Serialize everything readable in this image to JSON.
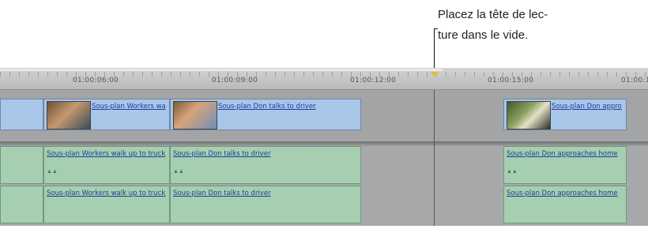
{
  "callout": {
    "line1": "Placez la tête de lec-",
    "line2": "ture dans le vide."
  },
  "ruler": {
    "timecodes": [
      "01:00:06:00",
      "01:00:09:00",
      "01:00:12:00",
      "01:00:15:00",
      "01:00:1"
    ]
  },
  "video_clips": [
    {
      "label": "Sous-plan Workers wa"
    },
    {
      "label": "Sous-plan Don talks to driver"
    },
    {
      "label": "Sous-plan Don appro"
    }
  ],
  "audio_track_1": [
    {
      "label": "Sous-plan Workers walk up to truck"
    },
    {
      "label": "Sous-plan Don talks to driver"
    },
    {
      "label": "Sous-plan Don approaches home"
    }
  ],
  "audio_track_2": [
    {
      "label": "Sous-plan Workers walk up to truck"
    },
    {
      "label": "Sous-plan Don talks to driver"
    },
    {
      "label": "Sous-plan Don approaches home"
    }
  ],
  "colors": {
    "video_clip": "#a8c6e8",
    "audio_clip": "#a5cfb0",
    "playhead": "#e8c020",
    "clip_label": "#1e3c9a"
  }
}
